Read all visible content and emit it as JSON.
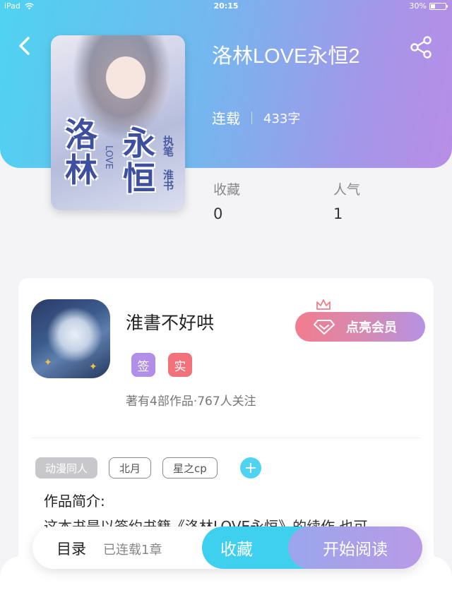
{
  "status_bar": {
    "device": "iPad",
    "time": "20:15",
    "battery": "30%"
  },
  "book": {
    "title": "洛林LOVE永恒2",
    "status": "连载",
    "word_count": "433字",
    "cover": {
      "char1": "洛",
      "char2": "林",
      "char3": "永",
      "char4": "恒",
      "side1": "执笔",
      "side2": "淮书",
      "love": "LOVE"
    }
  },
  "stats": [
    {
      "label": "收藏",
      "value": "0"
    },
    {
      "label": "人气",
      "value": "1"
    }
  ],
  "author": {
    "name": "淮書不好哄",
    "badges": [
      "签",
      "实"
    ],
    "summary": "著有4部作品·767人关注",
    "vip_button": "点亮会员"
  },
  "tags": [
    "动漫同人",
    "北月",
    "星之cp"
  ],
  "tag_add": "+",
  "intro": {
    "heading": "作品简介:",
    "text": "这本书是以签约书籍《洛林LOVE永恒》的续作,也可"
  },
  "bottom_bar": {
    "toc_label": "目录",
    "chapters_label": "已连载1章",
    "favorite_button": "收藏",
    "read_button": "开始阅读"
  },
  "colors": {
    "header_start": "#4fd3f1",
    "header_end": "#b88ee6",
    "accent_cyan": "#3fd0f0",
    "vip_pink": "#f37c8d",
    "badge_sign": "#b18ee8",
    "badge_real": "#f2727b"
  }
}
